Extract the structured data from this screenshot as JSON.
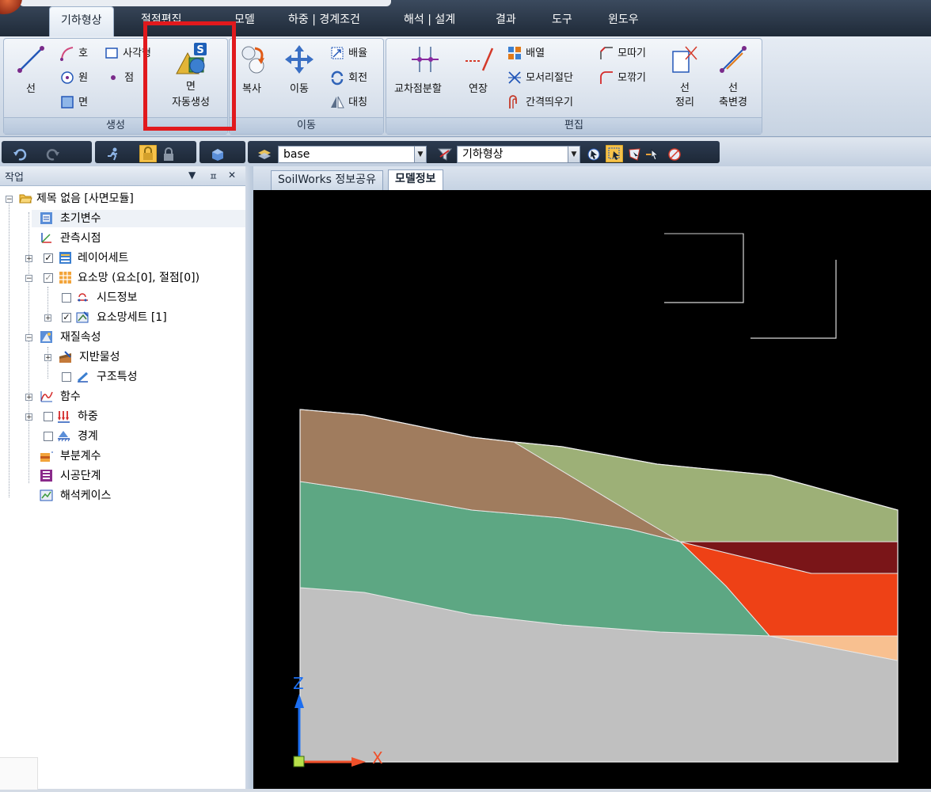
{
  "ribbon_tabs": [
    "기하형상",
    "절점편집",
    "모델",
    "하중 | 경계조건",
    "해석 | 설계",
    "결과",
    "도구",
    "윈도우"
  ],
  "groups": {
    "create": {
      "label": "생성",
      "line": "선",
      "arc": "호",
      "rectangle": "사각형",
      "circle": "원",
      "point": "점",
      "face": "면",
      "auto_face_line1": "면",
      "auto_face_line2": "자동생성"
    },
    "move": {
      "label": "이동",
      "copy": "복사",
      "move": "이동",
      "scale": "배율",
      "rotate": "회전",
      "mirror": "대칭"
    },
    "edit": {
      "label": "편집",
      "intersect": "교차점분할",
      "extend": "연장",
      "array": "배열",
      "corner_trim": "모서리절단",
      "offset": "간격띄우기",
      "chamfer": "모따기",
      "fillet": "모깎기",
      "line_clean_1": "선",
      "line_clean_2": "정리",
      "line_axis_1": "선",
      "line_axis_2": "축변경"
    }
  },
  "toolbar": {
    "layer_value": "base",
    "filter_value": "기하형상"
  },
  "panel": {
    "title": "작업",
    "pin": "ㅍ",
    "close": "✕",
    "dropdown": "▼",
    "tree": [
      {
        "label": "제목 없음 [사면모듈]"
      },
      {
        "label": "초기변수"
      },
      {
        "label": "관측시점"
      },
      {
        "label": "레이어세트"
      },
      {
        "label": "요소망 (요소[0], 절점[0])"
      },
      {
        "label": "시드정보"
      },
      {
        "label": "요소망세트 [1]"
      },
      {
        "label": "재질속성"
      },
      {
        "label": "지반물성"
      },
      {
        "label": "구조특성"
      },
      {
        "label": "함수"
      },
      {
        "label": "하중"
      },
      {
        "label": "경계"
      },
      {
        "label": "부분계수"
      },
      {
        "label": "시공단계"
      },
      {
        "label": "해석케이스"
      }
    ]
  },
  "doc_tabs": [
    "SoilWorks 정보공유",
    "모델정보"
  ],
  "axis": {
    "z": "Z",
    "x": "X"
  },
  "colors": {
    "soil_brown": "#a07c5e",
    "soil_olive": "#9db077",
    "soil_green": "#5da783",
    "soil_grey": "#c0c0c0",
    "soil_darkred": "#7a1518",
    "soil_orange": "#ee4116",
    "soil_peach": "#f8c090",
    "highlight_red": "#e1191d"
  }
}
